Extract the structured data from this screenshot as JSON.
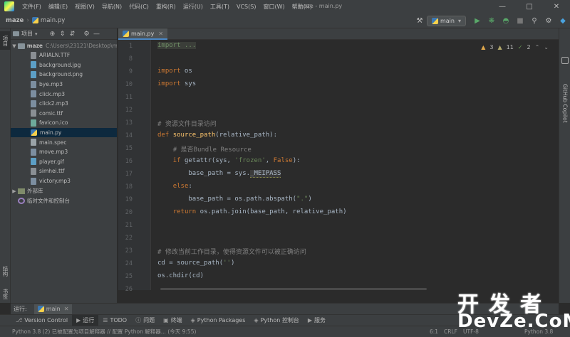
{
  "menubar": {
    "items": [
      "文件(F)",
      "编辑(E)",
      "视图(V)",
      "导航(N)",
      "代码(C)",
      "重构(R)",
      "运行(U)",
      "工具(T)",
      "VCS(S)",
      "窗口(W)",
      "帮助(H)"
    ],
    "window_title": "maze - main.py"
  },
  "navbar": {
    "project": "maze",
    "file": "main.py",
    "run_config": "main"
  },
  "left_strip": {
    "project_tab": "项目",
    "structure_tab": "结构",
    "bookmarks_tab": "书签"
  },
  "project_panel": {
    "title": "项目",
    "root_name": "maze",
    "root_path": "C:\\Users\\23121\\Desktop\\m",
    "files": [
      "ARIALN.TTF",
      "background.jpg",
      "background.png",
      "bye.mp3",
      "click.mp3",
      "click2.mp3",
      "comic.ttf",
      "favicon.ico",
      "main.py",
      "main.spec",
      "move.mp3",
      "player.gif",
      "simhei.ttf",
      "victory.mp3"
    ],
    "external_libs": "外部库",
    "scratches": "临时文件和控制台"
  },
  "editor": {
    "tab_label": "main.py",
    "inspections": {
      "warnings": "3",
      "weak_warnings": "11",
      "typos": "2"
    },
    "line_numbers": [
      "1",
      "8",
      "9",
      "10",
      "11",
      "12",
      "13",
      "14",
      "15",
      "16",
      "17",
      "18",
      "19",
      "20",
      "21",
      "22",
      "23",
      "24",
      "25",
      "26"
    ],
    "lines": {
      "l1_fold": "import ...",
      "l9_kw": "import",
      "l9_rest": " os",
      "l10_kw": "import",
      "l10_rest": " sys",
      "l13_comment": "# 资源文件目录访问",
      "l14_kw": "def ",
      "l14_fn": "source_path",
      "l14_rest": "(relative_path):",
      "l15_comment": "# 是否Bundle Resource",
      "l16_kw": "if ",
      "l16_a": "getattr(sys, ",
      "l16_str": "'frozen'",
      "l16_b": ", ",
      "l16_kw2": "False",
      "l16_c": "):",
      "l17_a": "base_path = sys.",
      "l17_hl": "_MEIPASS",
      "l18_kw": "else",
      "l18_rest": ":",
      "l19_a": "base_path = os.path.abspath(",
      "l19_str": "\".\"",
      "l19_b": ")",
      "l20_kw": "return ",
      "l20_rest": "os.path.join(base_path, relative_path)",
      "l23_comment": "# 修改当前工作目录，使得资源文件可以被正确访问",
      "l24_a": "cd = source_path(",
      "l24_str": "''",
      "l24_b": ")",
      "l25": "os.chdir(cd)"
    }
  },
  "right_strip": {
    "copilot": "GitHub Copilot"
  },
  "run_bar": {
    "label": "运行:",
    "tab": "main"
  },
  "toolbar": {
    "tabs": [
      {
        "icon": "version-control-icon",
        "label": "Version Control"
      },
      {
        "icon": "run-icon",
        "label": "运行"
      },
      {
        "icon": "todo-icon",
        "label": "TODO"
      },
      {
        "icon": "problems-icon",
        "label": "问题"
      },
      {
        "icon": "terminal-icon",
        "label": "终端"
      },
      {
        "icon": "python-packages-icon",
        "label": "Python Packages"
      },
      {
        "icon": "python-console-icon",
        "label": "Python 控制台"
      },
      {
        "icon": "services-icon",
        "label": "服务"
      }
    ]
  },
  "statusbar": {
    "message": "Python 3.8 (2) 已被配置为项目解释器 // 配置 Python 解释器... (今天 9:55)",
    "position": "6:1",
    "line_sep": "CRLF",
    "encoding": "UTF-8",
    "interpreter": "Python 3.8"
  },
  "watermark": {
    "cn": "开发者",
    "en": "DevZe.CoM"
  },
  "colors": {
    "accent": "#4a88c7",
    "background": "#2b2b2b",
    "panel": "#3c3f41",
    "keyword": "#cc7832",
    "string": "#6a8759",
    "function": "#ffc66d",
    "comment": "#808080"
  }
}
